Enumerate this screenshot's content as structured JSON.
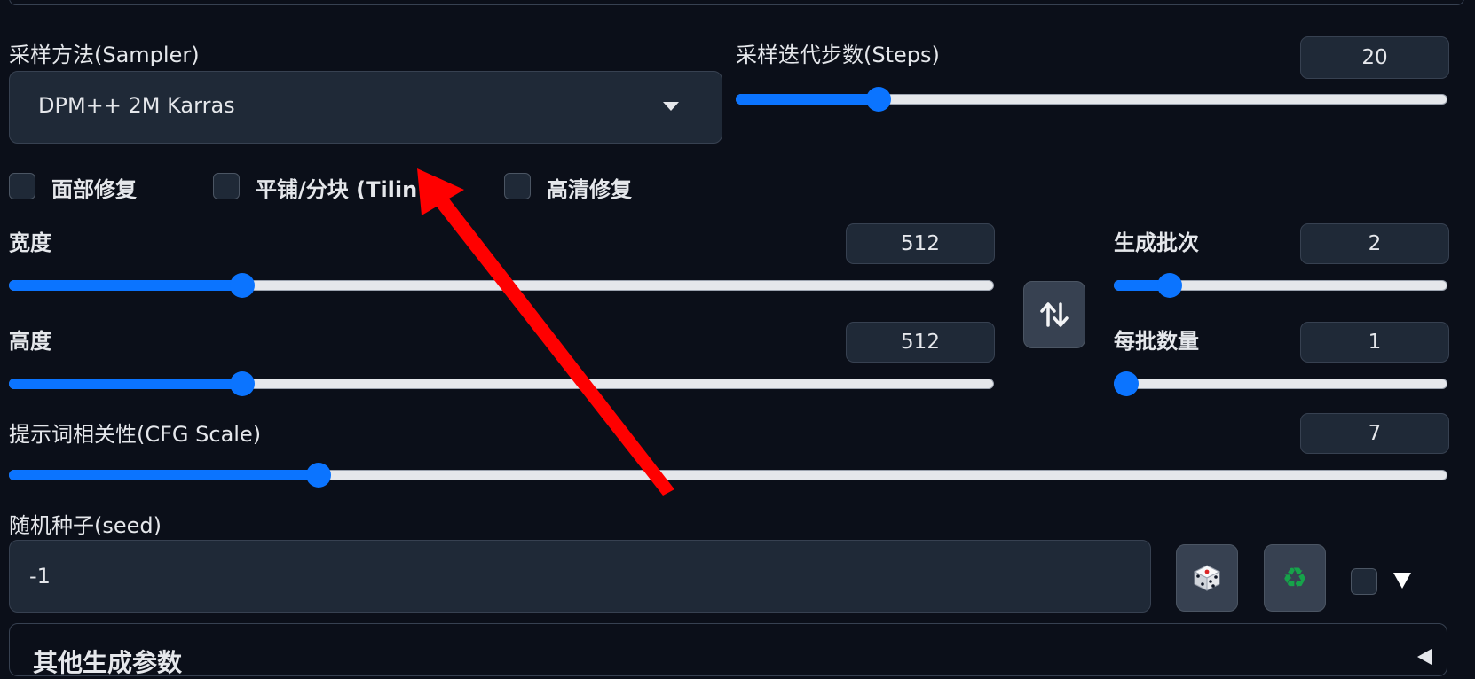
{
  "sampler": {
    "label": "采样方法(Sampler)",
    "value": "DPM++ 2M Karras"
  },
  "steps": {
    "label": "采样迭代步数(Steps)",
    "value": "20",
    "fraction": 0.19
  },
  "options": {
    "face_restore": "面部修复",
    "tiling": "平铺/分块 (Tilin",
    "hires_fix": "高清修复"
  },
  "width": {
    "label": "宽度",
    "value": "512",
    "fraction": 0.23
  },
  "height": {
    "label": "高度",
    "value": "512",
    "fraction": 0.23
  },
  "batch_count": {
    "label": "生成批次",
    "value": "2",
    "fraction": 0.14
  },
  "batch_size": {
    "label": "每批数量",
    "value": "1",
    "fraction": 0.0
  },
  "cfg": {
    "label": "提示词相关性(CFG Scale)",
    "value": "7",
    "fraction": 0.21
  },
  "seed": {
    "label": "随机种子(seed)",
    "value": "-1"
  },
  "extra": {
    "label": "其他生成参数"
  },
  "icons": {
    "swap": "swap-arrows-icon",
    "dice": "dice-icon",
    "recycle": "recycle-icon",
    "dropdown": "chevron-down-icon",
    "annotation": "red-arrow-annotation"
  },
  "colors": {
    "accent": "#0b74ff",
    "background": "#0b0f19",
    "annotation": "#ff0000"
  }
}
